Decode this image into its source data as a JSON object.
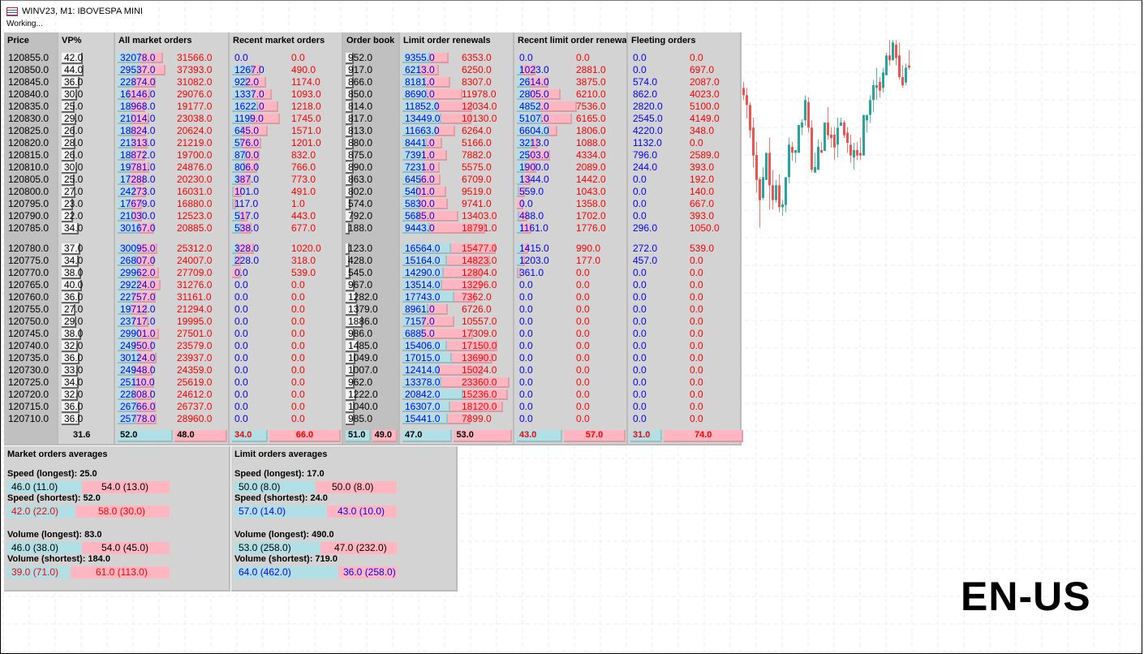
{
  "window": {
    "title": "WINV23, M1:  IBOVESPA MINI",
    "status": "Working..."
  },
  "headers": {
    "price": "Price",
    "vp": "VP%",
    "all": "All market orders",
    "recent": "Recent market orders",
    "book": "Order book",
    "lor": "Limit order renewals",
    "rlr": "Recent limit order renewals",
    "fleet": "Fleeting orders"
  },
  "rows_top": [
    [
      "120855.0",
      "42.0",
      "32078.0",
      "31566.0",
      "0.0",
      "0.0",
      "952.0",
      "9355.0",
      "6353.0",
      "0.0",
      "0.0",
      "0.0",
      "0.0"
    ],
    [
      "120850.0",
      "44.0",
      "29537.0",
      "37393.0",
      "1267.0",
      "490.0",
      "917.0",
      "6213.0",
      "6250.0",
      "1023.0",
      "2881.0",
      "0.0",
      "697.0"
    ],
    [
      "120845.0",
      "36.0",
      "22874.0",
      "31082.0",
      "922.0",
      "1174.0",
      "866.0",
      "8181.0",
      "8307.0",
      "2614.0",
      "3875.0",
      "574.0",
      "2087.0"
    ],
    [
      "120840.0",
      "30.0",
      "16146.0",
      "29076.0",
      "1337.0",
      "1093.0",
      "850.0",
      "8690.0",
      "11978.0",
      "2805.0",
      "6210.0",
      "862.0",
      "4023.0"
    ],
    [
      "120835.0",
      "25.0",
      "18968.0",
      "19177.0",
      "1622.0",
      "1218.0",
      "814.0",
      "11852.0",
      "12034.0",
      "4852.0",
      "7536.0",
      "2820.0",
      "5100.0"
    ],
    [
      "120830.0",
      "29.0",
      "21014.0",
      "23038.0",
      "1199.0",
      "1745.0",
      "817.0",
      "13449.0",
      "10130.0",
      "5107.0",
      "6165.0",
      "2545.0",
      "4149.0"
    ],
    [
      "120825.0",
      "26.0",
      "18824.0",
      "20624.0",
      "645.0",
      "1571.0",
      "813.0",
      "11663.0",
      "6264.0",
      "6604.0",
      "1806.0",
      "4220.0",
      "348.0"
    ],
    [
      "120820.0",
      "28.0",
      "21313.0",
      "21219.0",
      "576.0",
      "1201.0",
      "880.0",
      "8441.0",
      "5166.0",
      "3213.0",
      "1088.0",
      "1132.0",
      "0.0"
    ],
    [
      "120815.0",
      "26.0",
      "18872.0",
      "19700.0",
      "870.0",
      "832.0",
      "875.0",
      "7391.0",
      "7882.0",
      "2503.0",
      "4334.0",
      "796.0",
      "2589.0"
    ],
    [
      "120810.0",
      "30.0",
      "19781.0",
      "24876.0",
      "806.0",
      "766.0",
      "890.0",
      "7231.0",
      "5575.0",
      "1900.0",
      "2089.0",
      "244.0",
      "393.0"
    ],
    [
      "120805.0",
      "25.0",
      "17288.0",
      "20230.0",
      "387.0",
      "773.0",
      "863.0",
      "6456.0",
      "6709.0",
      "1344.0",
      "1442.0",
      "0.0",
      "192.0"
    ],
    [
      "120800.0",
      "27.0",
      "24273.0",
      "16031.0",
      "101.0",
      "491.0",
      "802.0",
      "5401.0",
      "9519.0",
      "559.0",
      "1043.0",
      "0.0",
      "140.0"
    ],
    [
      "120795.0",
      "23.0",
      "17679.0",
      "16880.0",
      "117.0",
      "1.0",
      "574.0",
      "5830.0",
      "9741.0",
      "0.0",
      "1358.0",
      "0.0",
      "667.0"
    ],
    [
      "120790.0",
      "22.0",
      "21030.0",
      "12523.0",
      "517.0",
      "443.0",
      "792.0",
      "5685.0",
      "13403.0",
      "488.0",
      "1702.0",
      "0.0",
      "393.0"
    ],
    [
      "120785.0",
      "34.0",
      "30167.0",
      "20885.0",
      "538.0",
      "677.0",
      "188.0",
      "9443.0",
      "18791.0",
      "1161.0",
      "1776.0",
      "296.0",
      "1050.0"
    ]
  ],
  "rows_bottom": [
    [
      "120780.0",
      "37.0",
      "30095.0",
      "25312.0",
      "328.0",
      "1020.0",
      "123.0",
      "16564.0",
      "15477.0",
      "1415.0",
      "990.0",
      "272.0",
      "539.0"
    ],
    [
      "120775.0",
      "34.0",
      "26807.0",
      "24007.0",
      "228.0",
      "318.0",
      "428.0",
      "15164.0",
      "14823.0",
      "1203.0",
      "177.0",
      "457.0",
      "0.0"
    ],
    [
      "120770.0",
      "38.0",
      "29962.0",
      "27709.0",
      "0.0",
      "539.0",
      "545.0",
      "14290.0",
      "12804.0",
      "361.0",
      "0.0",
      "0.0",
      "0.0"
    ],
    [
      "120765.0",
      "40.0",
      "29224.0",
      "31276.0",
      "0.0",
      "0.0",
      "967.0",
      "13514.0",
      "13296.0",
      "0.0",
      "0.0",
      "0.0",
      "0.0"
    ],
    [
      "120760.0",
      "36.0",
      "22757.0",
      "31161.0",
      "0.0",
      "0.0",
      "1282.0",
      "17743.0",
      "7362.0",
      "0.0",
      "0.0",
      "0.0",
      "0.0"
    ],
    [
      "120755.0",
      "27.0",
      "19712.0",
      "21294.0",
      "0.0",
      "0.0",
      "1379.0",
      "8961.0",
      "6726.0",
      "0.0",
      "0.0",
      "0.0",
      "0.0"
    ],
    [
      "120750.0",
      "29.0",
      "23717.0",
      "19995.0",
      "0.0",
      "0.0",
      "1886.0",
      "7157.0",
      "10557.0",
      "0.0",
      "0.0",
      "0.0",
      "0.0"
    ],
    [
      "120745.0",
      "38.0",
      "29901.0",
      "27501.0",
      "0.0",
      "0.0",
      "986.0",
      "6885.0",
      "17309.0",
      "0.0",
      "0.0",
      "0.0",
      "0.0"
    ],
    [
      "120740.0",
      "32.0",
      "24950.0",
      "23579.0",
      "0.0",
      "0.0",
      "1485.0",
      "15406.0",
      "17150.0",
      "0.0",
      "0.0",
      "0.0",
      "0.0"
    ],
    [
      "120735.0",
      "36.0",
      "30124.0",
      "23937.0",
      "0.0",
      "0.0",
      "1049.0",
      "17015.0",
      "13690.0",
      "0.0",
      "0.0",
      "0.0",
      "0.0"
    ],
    [
      "120730.0",
      "33.0",
      "24948.0",
      "24359.0",
      "0.0",
      "0.0",
      "1007.0",
      "12414.0",
      "15024.0",
      "0.0",
      "0.0",
      "0.0",
      "0.0"
    ],
    [
      "120725.0",
      "34.0",
      "25110.0",
      "25619.0",
      "0.0",
      "0.0",
      "962.0",
      "13378.0",
      "23360.0",
      "0.0",
      "0.0",
      "0.0",
      "0.0"
    ],
    [
      "120720.0",
      "32.0",
      "22808.0",
      "24612.0",
      "0.0",
      "0.0",
      "1222.0",
      "20842.0",
      "15236.0",
      "0.0",
      "0.0",
      "0.0",
      "0.0"
    ],
    [
      "120715.0",
      "36.0",
      "26766.0",
      "26737.0",
      "0.0",
      "0.0",
      "1040.0",
      "16307.0",
      "18120.0",
      "0.0",
      "0.0",
      "0.0",
      "0.0"
    ],
    [
      "120710.0",
      "36.0",
      "25778.0",
      "28960.0",
      "0.0",
      "0.0",
      "985.0",
      "15441.0",
      "7899.0",
      "0.0",
      "0.0",
      "0.0",
      "0.0"
    ]
  ],
  "footer": {
    "vp": "31.6",
    "all": [
      "52.0",
      "48.0"
    ],
    "recent": [
      "34.0",
      "66.0"
    ],
    "book": [
      "51.0",
      "49.0"
    ],
    "lor": [
      "47.0",
      "53.0"
    ],
    "rlr": [
      "43.0",
      "57.0"
    ],
    "fleet": [
      "31.0",
      "74.0"
    ]
  },
  "market_avg": {
    "title": "Market orders averages",
    "items": [
      {
        "label": "Speed (longest): 25.0",
        "buy": "46.0 (11.0)",
        "sell": "54.0 (13.0)",
        "pct": 46,
        "color": "#000000"
      },
      {
        "label": "Speed (shortest): 52.0",
        "buy": "42.0 (22.0)",
        "sell": "58.0 (30.0)",
        "pct": 42,
        "color": "#ff0000"
      },
      {
        "label": "Volume (longest): 83.0",
        "buy": "46.0 (38.0)",
        "sell": "54.0 (45.0)",
        "pct": 46,
        "color": "#000000"
      },
      {
        "label": "Volume (shortest): 184.0",
        "buy": "39.0 (71.0)",
        "sell": "61.0 (113.0)",
        "pct": 39,
        "color": "#ff0000"
      }
    ]
  },
  "limit_avg": {
    "title": "Limit orders averages",
    "items": [
      {
        "label": "Speed (longest): 17.0",
        "buy": "50.0 (8.0)",
        "sell": "50.0 (8.0)",
        "pct": 50,
        "color": "#000000"
      },
      {
        "label": "Speed (shortest): 24.0",
        "buy": "57.0 (14.0)",
        "sell": "43.0 (10.0)",
        "pct": 57,
        "color": "#0000ff"
      },
      {
        "label": "Volume (longest): 490.0",
        "buy": "53.0 (258.0)",
        "sell": "47.0 (232.0)",
        "pct": 53,
        "color": "#000000"
      },
      {
        "label": "Volume (shortest): 719.0",
        "buy": "64.0 (462.0)",
        "sell": "36.0 (258.0)",
        "pct": 64,
        "color": "#0000ff"
      }
    ]
  },
  "locale_label": "EN-US",
  "colors": {
    "buy": "#0000ff",
    "sell": "#ff0000",
    "bull": "#26a69a",
    "bear": "#ef5350"
  },
  "candles": [
    [
      595,
      617,
      550,
      568
    ],
    [
      568,
      595,
      482,
      532
    ],
    [
      532,
      542,
      410,
      438
    ],
    [
      448,
      485,
      300,
      345
    ],
    [
      347,
      395,
      208,
      255
    ],
    [
      257,
      265,
      78,
      180
    ],
    [
      188,
      302,
      180,
      265
    ],
    [
      255,
      355,
      255,
      355
    ],
    [
      355,
      412,
      145,
      235
    ],
    [
      235,
      292,
      145,
      180
    ],
    [
      180,
      255,
      170,
      235
    ],
    [
      235,
      275,
      135,
      154
    ],
    [
      154,
      180,
      122,
      164
    ],
    [
      162,
      265,
      135,
      265
    ],
    [
      265,
      412,
      242,
      385
    ],
    [
      377,
      395,
      325,
      355
    ],
    [
      355,
      365,
      318,
      365
    ],
    [
      355,
      458,
      355,
      458
    ],
    [
      448,
      480,
      420,
      467
    ],
    [
      475,
      568,
      455,
      550
    ],
    [
      542,
      560,
      430,
      448
    ],
    [
      448,
      475,
      282,
      292
    ],
    [
      282,
      355,
      282,
      302
    ],
    [
      292,
      405,
      292,
      377
    ],
    [
      365,
      395,
      355,
      355
    ],
    [
      362,
      467,
      362,
      467
    ],
    [
      467,
      525,
      402,
      420
    ],
    [
      422,
      450,
      375,
      410
    ],
    [
      422,
      450,
      328,
      375
    ],
    [
      385,
      485,
      338,
      448
    ],
    [
      455,
      485,
      455,
      467
    ],
    [
      467,
      475,
      410,
      420
    ],
    [
      430,
      450,
      355,
      392
    ],
    [
      385,
      422,
      318,
      345
    ],
    [
      338,
      392,
      292,
      365
    ],
    [
      365,
      395,
      328,
      345
    ],
    [
      355,
      412,
      328,
      345
    ],
    [
      345,
      495,
      345,
      495
    ],
    [
      475,
      495,
      430,
      495
    ],
    [
      495,
      568,
      465,
      550
    ],
    [
      550,
      625,
      505,
      605
    ],
    [
      595,
      670,
      550,
      605
    ],
    [
      617,
      635,
      558,
      585
    ],
    [
      595,
      670,
      578,
      652
    ],
    [
      642,
      725,
      642,
      715
    ],
    [
      715,
      772,
      678,
      697
    ],
    [
      697,
      772,
      697,
      763
    ],
    [
      755,
      772,
      678,
      705
    ],
    [
      715,
      763,
      625,
      635
    ],
    [
      635,
      678,
      595,
      605
    ],
    [
      615,
      685,
      605,
      670
    ],
    [
      678,
      735,
      662,
      670
    ]
  ]
}
